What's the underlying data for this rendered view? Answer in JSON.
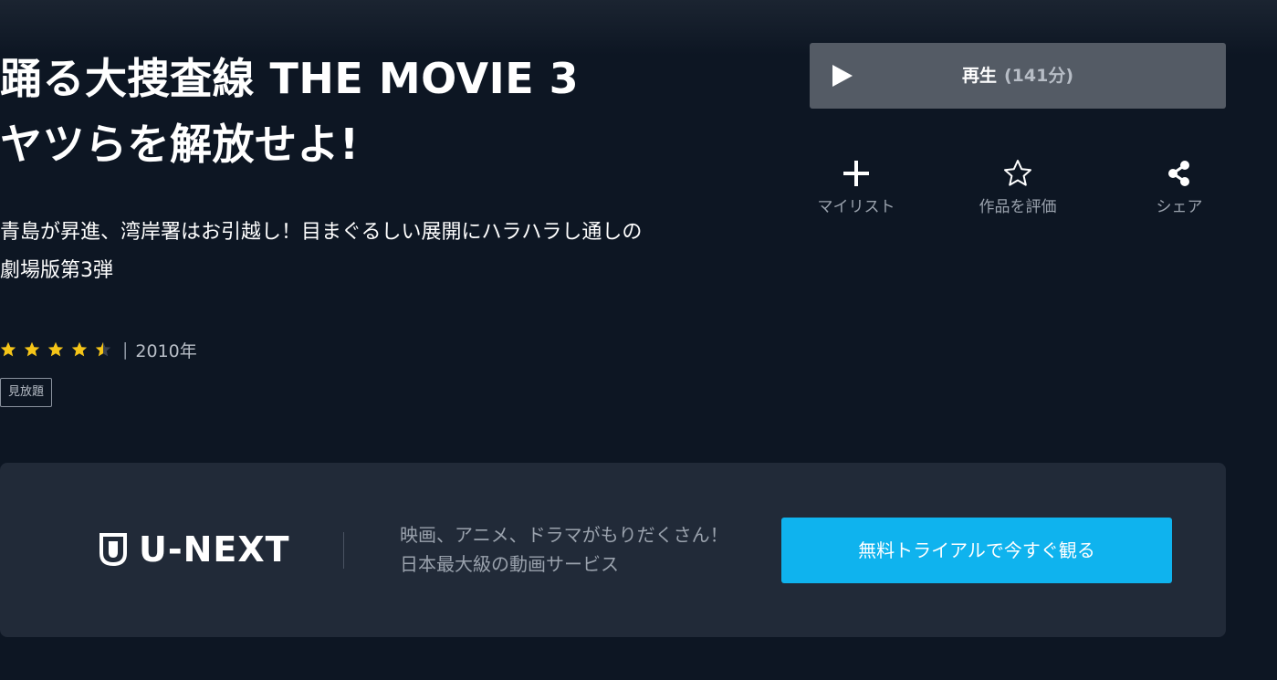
{
  "movie": {
    "title_line1": "踊る大捜査線 THE MOVIE 3",
    "title_line2": "ヤツらを解放せよ!",
    "description": "青島が昇進、湾岸署はお引越し！目まぐるしい展開にハラハラし通しの劇場版第3弾",
    "rating": 4.5,
    "rating_max": 5,
    "meta_separator": "|",
    "year": "2010年",
    "badge": "見放題"
  },
  "play": {
    "label": "再生",
    "duration": "(141分)",
    "icon": "play-icon"
  },
  "actions": [
    {
      "icon": "plus-icon",
      "label": "マイリスト"
    },
    {
      "icon": "star-outline-icon",
      "label": "作品を評価"
    },
    {
      "icon": "share-icon",
      "label": "シェア"
    }
  ],
  "banner": {
    "logo_text": "U-NEXT",
    "logo_icon": "shield-icon",
    "text_line1": "映画、アニメ、ドラマがもりだくさん！",
    "text_line2": "日本最大級の動画サービス",
    "cta_label": "無料トライアルで今すぐ観る"
  },
  "colors": {
    "background": "#0d1623",
    "star": "#f5c518",
    "play_button": "#545b65",
    "banner_background": "#212a38",
    "cta": "#0fb3ee"
  }
}
